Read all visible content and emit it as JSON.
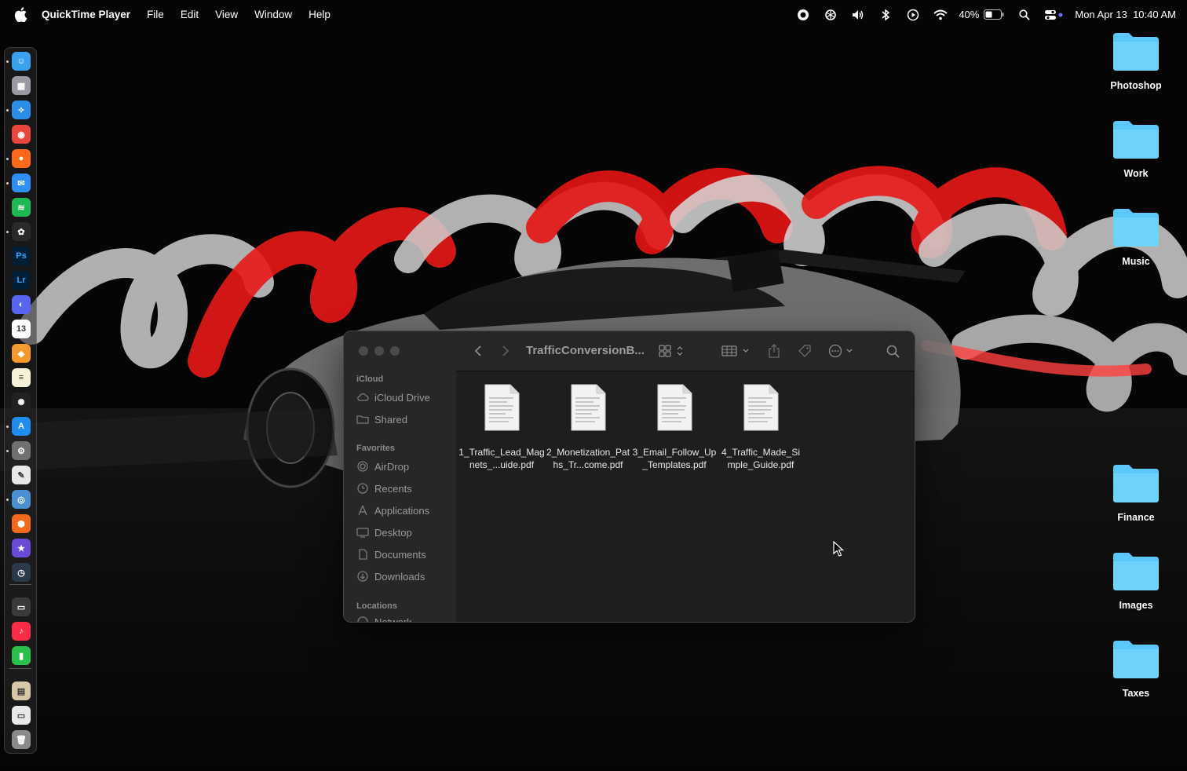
{
  "menubar": {
    "app_name": "QuickTime Player",
    "menus": [
      "File",
      "Edit",
      "View",
      "Window",
      "Help"
    ],
    "status_icons": [
      "record-icon",
      "chatgpt-icon",
      "volume-icon",
      "bluetooth-icon",
      "play-icon",
      "wifi-icon"
    ],
    "battery_percent": "40%",
    "datetime": "Mon Apr 13  10:40 AM"
  },
  "dock": {
    "apps": [
      {
        "name": "Finder",
        "icon": "finder-icon",
        "color": "#3aa0f0",
        "glyph": "☺"
      },
      {
        "name": "Launchpad",
        "icon": "launchpad-icon",
        "color": "#9a9aa2",
        "glyph": "▦"
      },
      {
        "name": "Safari",
        "icon": "safari-icon",
        "color": "#2a8de8",
        "glyph": "✧"
      },
      {
        "name": "Chrome",
        "icon": "chrome-icon",
        "color": "#e8453c",
        "glyph": "◉"
      },
      {
        "name": "Firefox",
        "icon": "firefox-icon",
        "color": "#ff6a1a",
        "glyph": "●"
      },
      {
        "name": "Mail",
        "icon": "mail-icon",
        "color": "#2f8ff5",
        "glyph": "✉"
      },
      {
        "name": "Spotify",
        "icon": "spotify-icon",
        "color": "#1db954",
        "glyph": "≋"
      },
      {
        "name": "ChatGPT",
        "icon": "chatgpt-icon",
        "color": "#2a2a2a",
        "glyph": "✿"
      },
      {
        "name": "Photoshop",
        "icon": "photoshop-icon",
        "color": "#001e36",
        "glyph": "Ps"
      },
      {
        "name": "Lightroom",
        "icon": "lightroom-icon",
        "color": "#001e36",
        "glyph": "Lr"
      },
      {
        "name": "Discord",
        "icon": "discord-icon",
        "color": "#5865f2",
        "glyph": "◐"
      },
      {
        "name": "Calendar",
        "icon": "calendar-icon",
        "color": "#ffffff",
        "glyph": "13"
      },
      {
        "name": "Sketch",
        "icon": "sketch-icon",
        "color": "#f79a2d",
        "glyph": "◆"
      },
      {
        "name": "Notes",
        "icon": "notes-icon",
        "color": "#f5f0d8",
        "glyph": "≡"
      },
      {
        "name": "ChatGPT Alt",
        "icon": "openai-icon",
        "color": "#222222",
        "glyph": "✺"
      },
      {
        "name": "App Store",
        "icon": "appstore-icon",
        "color": "#1f8cf0",
        "glyph": "A"
      },
      {
        "name": "System Settings",
        "icon": "settings-icon",
        "color": "#707070",
        "glyph": "⚙"
      },
      {
        "name": "TextEdit",
        "icon": "textedit-icon",
        "color": "#e8e8e8",
        "glyph": "✎"
      },
      {
        "name": "Preview",
        "icon": "preview-icon",
        "color": "#4a90d0",
        "glyph": "◎"
      },
      {
        "name": "Shapr",
        "icon": "shapr-icon",
        "color": "#f46a1c",
        "glyph": "⬢"
      },
      {
        "name": "iMovie",
        "icon": "imovie-icon",
        "color": "#6a4bd8",
        "glyph": "★"
      },
      {
        "name": "Time Machine",
        "icon": "timemachine-icon",
        "color": "#2a3a4a",
        "glyph": "◷"
      },
      {
        "name": "Screen Capture",
        "icon": "screencapture-icon",
        "color": "#3a3a3a",
        "glyph": "▭"
      },
      {
        "name": "Music",
        "icon": "music-icon",
        "color": "#fa2d48",
        "glyph": "♪"
      },
      {
        "name": "Numbers",
        "icon": "numbers-icon",
        "color": "#29c14a",
        "glyph": "▮"
      },
      {
        "name": "Photos Folder",
        "icon": "photos-stack-icon",
        "color": "#d9c8a8",
        "glyph": "▤"
      },
      {
        "name": "Window",
        "icon": "window-icon",
        "color": "#e8e8e8",
        "glyph": "▭"
      },
      {
        "name": "Trash",
        "icon": "trash-icon",
        "color": "#8a8a8a",
        "glyph": "🗑"
      }
    ]
  },
  "desktop_folders": [
    "Photoshop",
    "Work",
    "Music",
    "Finance",
    "Images",
    "Taxes"
  ],
  "finder": {
    "title": "TrafficConversionB...",
    "sidebar": {
      "icloud_header": "iCloud",
      "icloud_items": [
        "iCloud Drive",
        "Shared"
      ],
      "favorites_header": "Favorites",
      "favorites_items": [
        "AirDrop",
        "Recents",
        "Applications",
        "Desktop",
        "Documents",
        "Downloads"
      ],
      "locations_header": "Locations",
      "locations_items": [
        "Network"
      ]
    },
    "files": [
      {
        "name": "1_Traffic_Lead_Magnets_...uide.pdf"
      },
      {
        "name": "2_Monetization_Paths_Tr...come.pdf"
      },
      {
        "name": "3_Email_Follow_Up_Templates.pdf"
      },
      {
        "name": "4_Traffic_Made_Simple_Guide.pdf"
      }
    ]
  },
  "colors": {
    "folder_blue": "#5ac8fa",
    "light_red": "#e8191a",
    "light_white": "#d8d8d8"
  }
}
